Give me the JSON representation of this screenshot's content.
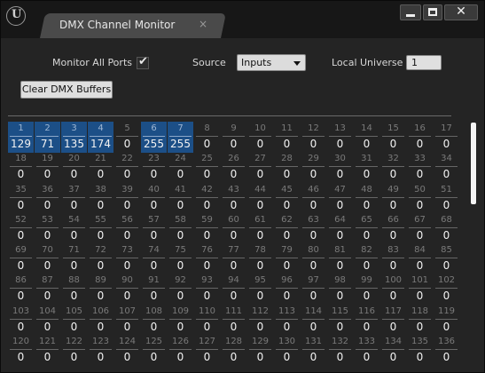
{
  "window": {
    "tab_title": "DMX Channel Monitor",
    "tab_close": "×",
    "logo_glyph": "U",
    "close_glyph": "✕"
  },
  "controls": {
    "monitor_all_ports_label": "Monitor All Ports",
    "monitor_all_ports_checked": true,
    "check_glyph": "✔",
    "source_label": "Source",
    "source_value": "Inputs",
    "local_universe_label": "Local Universe",
    "local_universe_value": "1",
    "clear_button_label": "Clear DMX Buffers"
  },
  "channels": {
    "visible_start": 1,
    "visible_end": 136,
    "per_row": 17,
    "values": {
      "1": "129",
      "2": "71",
      "3": "135",
      "4": "174",
      "6": "255",
      "7": "255"
    },
    "highlighted": [
      1,
      2,
      3,
      4,
      6,
      7
    ],
    "default_value": "0"
  }
}
